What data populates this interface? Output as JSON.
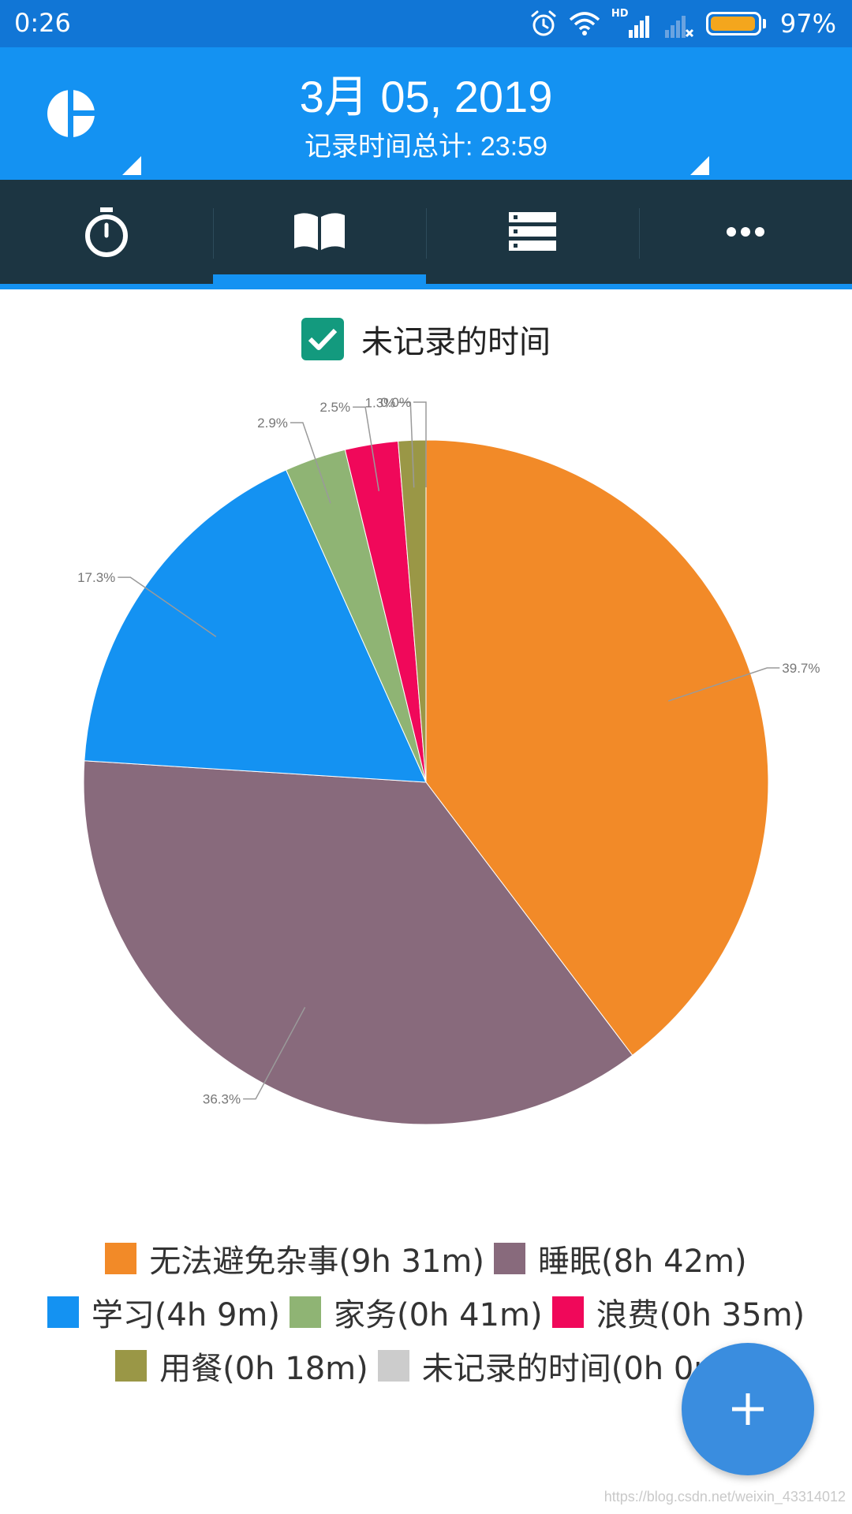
{
  "status_bar": {
    "time": "0:26",
    "network_label": "HD",
    "battery_percent": "97%",
    "battery_level": 0.97
  },
  "header": {
    "date": "3月 05, 2019",
    "total_label": "记录时间总计: 23:59"
  },
  "tabs": [
    {
      "icon": "stopwatch-icon",
      "active": false
    },
    {
      "icon": "book-icon",
      "active": true
    },
    {
      "icon": "list-icon",
      "active": false
    },
    {
      "icon": "more-icon",
      "active": false
    }
  ],
  "filter": {
    "label": "未记录的时间",
    "checked": true
  },
  "chart_data": {
    "type": "pie",
    "start": "top, clockwise",
    "slices": [
      {
        "legend": "无法避免杂事(9h 31m)",
        "pct": 39.7,
        "label": "39.7%",
        "color": "#f28a28"
      },
      {
        "legend": "睡眠(8h 42m)",
        "pct": 36.3,
        "label": "36.3%",
        "color": "#886a7c"
      },
      {
        "legend": "学习(4h 9m)",
        "pct": 17.3,
        "label": "17.3%",
        "color": "#1492f2"
      },
      {
        "legend": "家务(0h 41m)",
        "pct": 2.9,
        "label": "2.9%",
        "color": "#8fb474"
      },
      {
        "legend": "浪费(0h 35m)",
        "pct": 2.5,
        "label": "2.5%",
        "color": "#f0085a"
      },
      {
        "legend": "用餐(0h 18m)",
        "pct": 1.3,
        "label": "1.3%",
        "color": "#9a9746"
      },
      {
        "legend": "未记录的时间(0h 0m)",
        "pct": 0.0,
        "label": "0.0%",
        "color": "#cccccc"
      }
    ],
    "legend_rows": [
      [
        0,
        1
      ],
      [
        2,
        3,
        4
      ],
      [
        5,
        6
      ]
    ]
  },
  "fab": {
    "icon": "plus-icon"
  },
  "watermark": "https://blog.csdn.net/weixin_43314012",
  "colors": {
    "status_bar": "#1176d6",
    "header": "#1492f2",
    "tabbar": "#1c3542",
    "checkbox": "#139a7e",
    "fab": "#3a8ddf"
  }
}
